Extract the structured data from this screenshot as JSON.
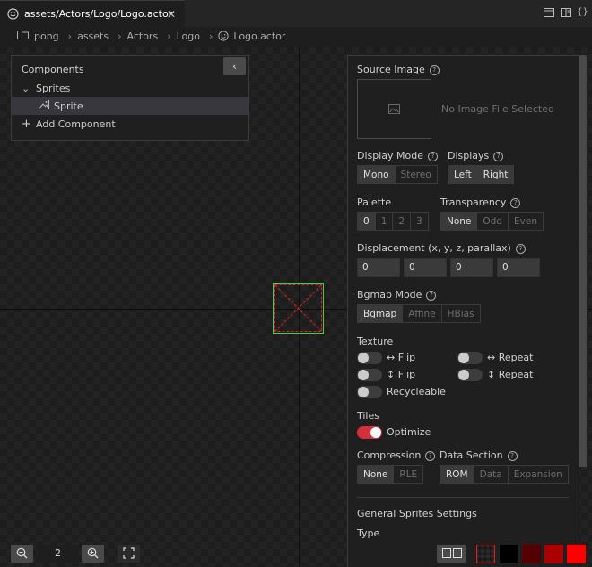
{
  "tab": {
    "title": "assets/Actors/Logo/Logo.actor",
    "close": "✕"
  },
  "toolbar_icons": [
    "split-editor-icon",
    "preview-icon",
    "code-icon"
  ],
  "breadcrumbs": [
    "pong",
    "assets",
    "Actors",
    "Logo",
    "Logo.actor"
  ],
  "components": {
    "title": "Components",
    "collapse_glyph": "‹",
    "group_label": "Sprites",
    "item_label": "Sprite",
    "add_label": "Add Component"
  },
  "props": {
    "source_image": "Source Image",
    "no_image": "No Image File Selected",
    "display_mode": {
      "label": "Display Mode",
      "options": [
        "Mono",
        "Stereo"
      ],
      "selected": "Mono"
    },
    "displays": {
      "label": "Displays",
      "options": [
        "Left",
        "Right"
      ],
      "selected": [
        "Left",
        "Right"
      ]
    },
    "palette": {
      "label": "Palette",
      "options": [
        "0",
        "1",
        "2",
        "3"
      ],
      "selected": "0"
    },
    "transparency": {
      "label": "Transparency",
      "options": [
        "None",
        "Odd",
        "Even"
      ],
      "selected": "None"
    },
    "displacement": {
      "label": "Displacement (x, y, z, parallax)",
      "values": [
        "0",
        "0",
        "0",
        "0"
      ]
    },
    "bgmap_mode": {
      "label": "Bgmap Mode",
      "options": [
        "Bgmap",
        "Affine",
        "HBias"
      ],
      "selected": "Bgmap"
    },
    "texture": {
      "label": "Texture",
      "h_flip": "↔ Flip",
      "h_repeat": "↔ Repeat",
      "v_flip": "↕ Flip",
      "v_repeat": "↕ Repeat",
      "recycleable": "Recycleable",
      "states": {
        "h_flip": false,
        "h_repeat": false,
        "v_flip": false,
        "v_repeat": false,
        "recycleable": false
      }
    },
    "tiles": {
      "label": "Tiles",
      "optimize": "Optimize",
      "optimize_on": true
    },
    "compression": {
      "label": "Compression",
      "options": [
        "None",
        "RLE"
      ],
      "selected": "None"
    },
    "data_section": {
      "label": "Data Section",
      "options": [
        "ROM",
        "Data",
        "Expansion"
      ],
      "selected": "ROM"
    },
    "general": "General Sprites Settings",
    "type_label": "Type"
  },
  "zoom": {
    "value": "2",
    "out_glyph": "−",
    "in_glyph": "+",
    "fit_glyph": "⛶"
  },
  "palette_swatches": [
    "#1a1a1a",
    "#000000",
    "#550000",
    "#aa0000",
    "#ff0000"
  ],
  "colors": {
    "accent": "#d2303a",
    "selection_border": "#3fd23f",
    "sprite_cross": "#e02020"
  }
}
